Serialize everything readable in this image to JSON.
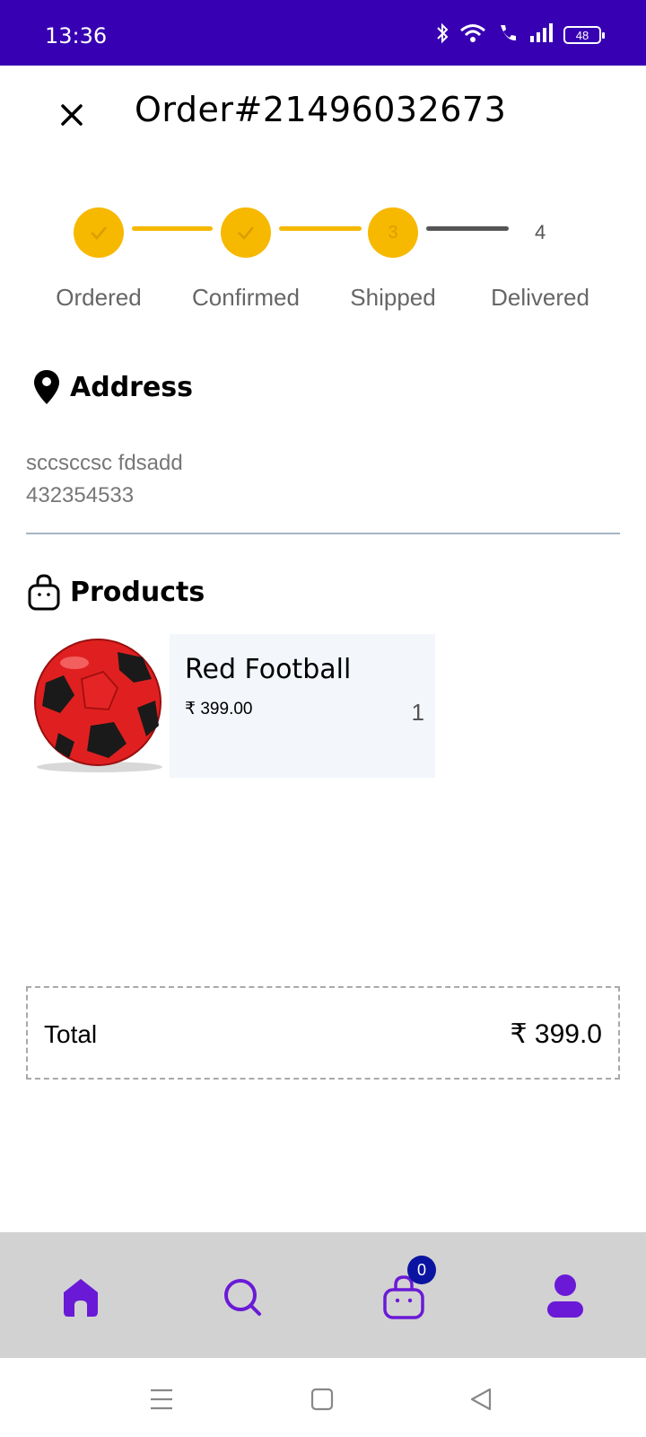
{
  "status_bar": {
    "time": "13:36",
    "battery": "48"
  },
  "header": {
    "title": "Order#21496032673"
  },
  "stepper": {
    "steps": [
      {
        "label": "Ordered",
        "number": "1",
        "state": "done"
      },
      {
        "label": "Confirmed",
        "number": "2",
        "state": "done"
      },
      {
        "label": "Shipped",
        "number": "3",
        "state": "current"
      },
      {
        "label": "Delivered",
        "number": "4",
        "state": "pending"
      }
    ],
    "active_color": "#f7b800",
    "pending_color": "#555555"
  },
  "address": {
    "heading": "Address",
    "line1": "sccsccsc fdsadd",
    "line2": "432354533"
  },
  "products": {
    "heading": "Products",
    "items": [
      {
        "name": "Red Football",
        "price": "₹ 399.00",
        "quantity": "1",
        "image": "red-football"
      }
    ]
  },
  "total": {
    "label": "Total",
    "value": "₹ 399.0"
  },
  "bottom_nav": {
    "items": [
      "home-icon",
      "search-icon",
      "cart-icon",
      "profile-icon"
    ],
    "cart_count": "0",
    "accent": "#6a1ad6"
  },
  "colors": {
    "status_bar": "#3700b3",
    "nav_bg": "#d3d2d2",
    "card_bg": "#f3f6fa"
  }
}
